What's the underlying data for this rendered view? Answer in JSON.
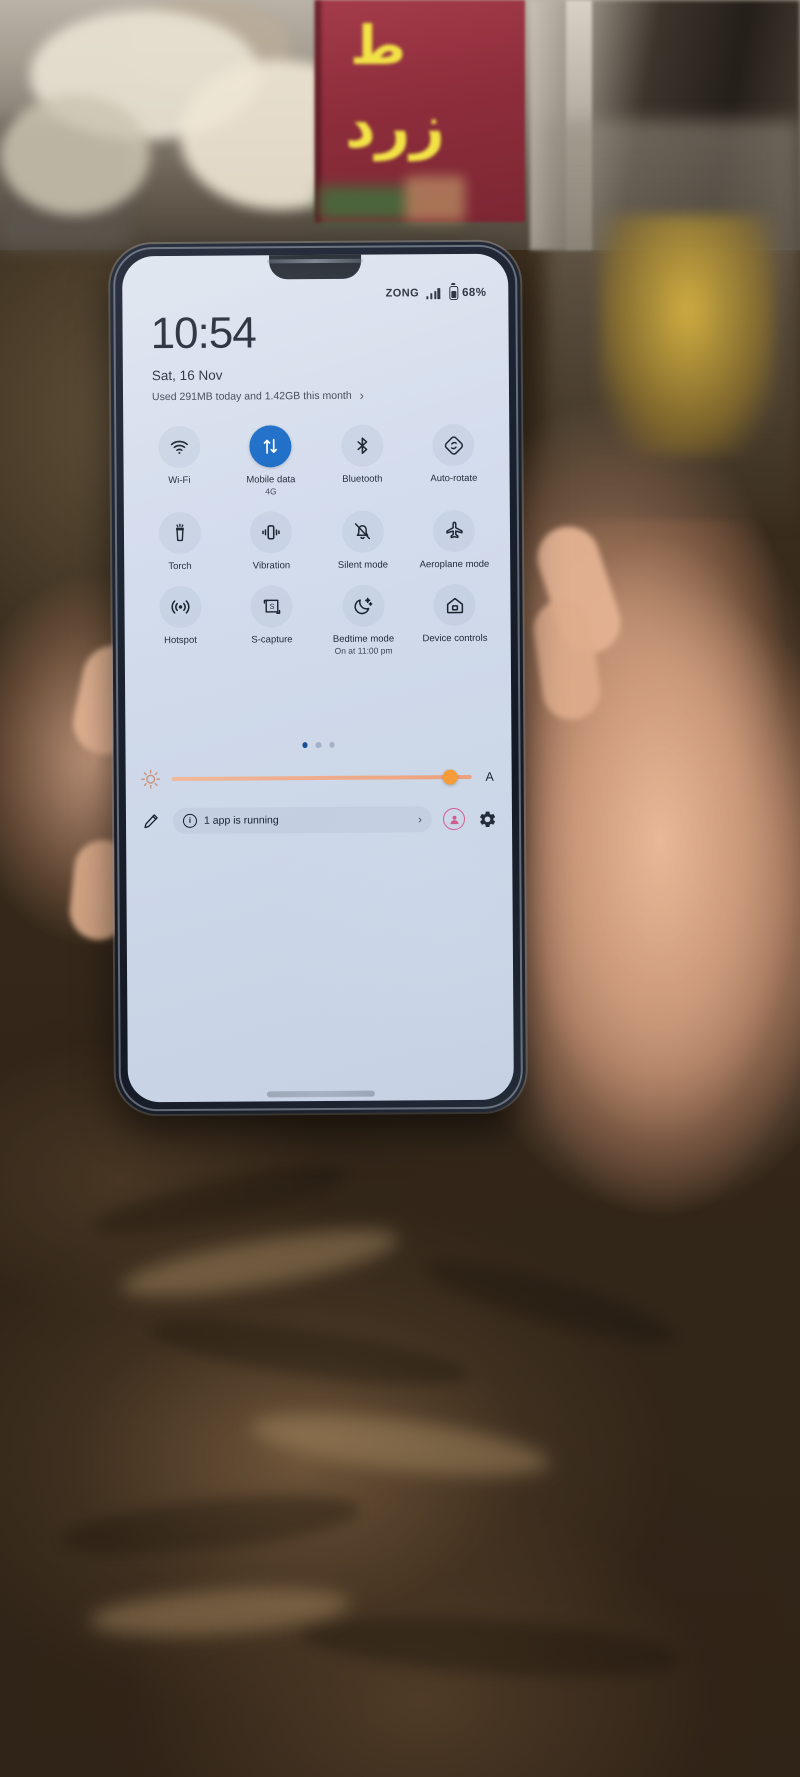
{
  "status_bar": {
    "carrier": "ZONG",
    "signal_icon": "signal-bars-icon",
    "battery_icon": "battery-icon",
    "battery_percent": "68%"
  },
  "header": {
    "clock": "10:54",
    "date": "Sat, 16 Nov",
    "data_usage": "Used 291MB today and 1.42GB this month",
    "data_usage_chevron": "›"
  },
  "tiles": [
    {
      "label": "Wi-Fi",
      "sub": "",
      "icon": "wifi-icon",
      "active": false
    },
    {
      "label": "Mobile data",
      "sub": "4G",
      "icon": "mobile-data-icon",
      "active": true
    },
    {
      "label": "Bluetooth",
      "sub": "",
      "icon": "bluetooth-icon",
      "active": false
    },
    {
      "label": "Auto-rotate",
      "sub": "",
      "icon": "auto-rotate-icon",
      "active": false
    },
    {
      "label": "Torch",
      "sub": "",
      "icon": "torch-icon",
      "active": false
    },
    {
      "label": "Vibration",
      "sub": "",
      "icon": "vibration-icon",
      "active": false
    },
    {
      "label": "Silent mode",
      "sub": "",
      "icon": "silent-mode-icon",
      "active": false
    },
    {
      "label": "Aeroplane mode",
      "sub": "",
      "icon": "aeroplane-icon",
      "active": false
    },
    {
      "label": "Hotspot",
      "sub": "",
      "icon": "hotspot-icon",
      "active": false
    },
    {
      "label": "S-capture",
      "sub": "",
      "icon": "s-capture-icon",
      "active": false
    },
    {
      "label": "Bedtime mode",
      "sub": "On at 11:00 pm",
      "icon": "bedtime-moon-icon",
      "active": false
    },
    {
      "label": "Device controls",
      "sub": "",
      "icon": "device-controls-icon",
      "active": false
    }
  ],
  "pager": {
    "total": 3,
    "active_index": 0
  },
  "brightness": {
    "icon": "brightness-icon",
    "auto_label": "A",
    "level_percent": 92
  },
  "footer": {
    "edit_icon": "pencil-edit-icon",
    "running_info_icon": "info-icon",
    "running_text": "1 app is running",
    "running_chevron": "›",
    "user_icon": "user-profile-icon",
    "settings_icon": "gear-icon"
  },
  "colors": {
    "accent_active_tile": "#1669c6",
    "brightness_knob": "#f59c38",
    "brightness_track": "#eeab8a",
    "pager_active": "#1a4f96",
    "user_ring": "#d1558a",
    "screen_bg": "#d3dced",
    "text_primary": "#16202c"
  },
  "scene": {
    "signboard_text_1": "ط",
    "signboard_text_2": "زرد"
  }
}
